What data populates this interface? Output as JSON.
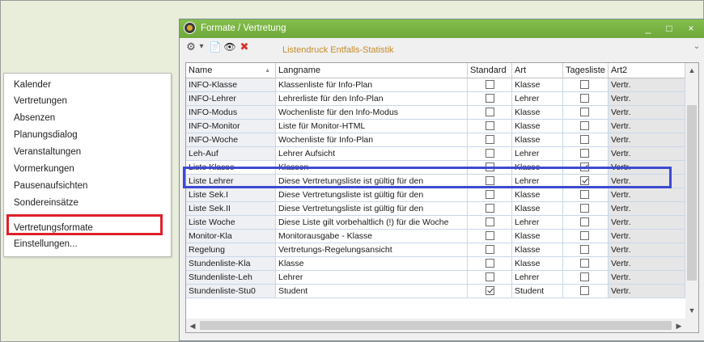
{
  "menu": {
    "items": [
      "Kalender",
      "Vertretungen",
      "Absenzen",
      "Planungsdialog",
      "Veranstaltungen",
      "Vormerkungen",
      "Pausenaufsichten",
      "Sondereinsätze",
      "Vertretungsformate",
      "Einstellungen..."
    ],
    "highlighted_item": "Vertretungsformate"
  },
  "window": {
    "title": "Formate / Vertretung",
    "minimize": "_",
    "maximize": "□",
    "close": "×",
    "titlebar_color": "#78b243"
  },
  "toolbar": {
    "tools": [
      {
        "icon": "tree-settings-icon",
        "glyph": "⚙"
      },
      {
        "icon": "dropdown-arrow-icon",
        "glyph": "▾"
      },
      {
        "icon": "new-document-icon",
        "glyph": "📄"
      },
      {
        "icon": "view-eye-icon",
        "glyph": "👁"
      },
      {
        "icon": "delete-icon",
        "glyph": "✖"
      }
    ],
    "overflow": "⌄"
  },
  "grid": {
    "headers": {
      "name": "Name",
      "langname": "Langname",
      "standard": "Standard",
      "art": "Art",
      "tagesliste": "Tagesliste",
      "art2": "Art2"
    },
    "overlap_text": "Listendruck Entfalls-Statistik",
    "rows": [
      {
        "name": "INFO-Klasse",
        "langname": "Klassenliste für Info-Plan",
        "standard": false,
        "art": "Klasse",
        "tagesliste": false,
        "art2": "Vertr."
      },
      {
        "name": "INFO-Lehrer",
        "langname": "Lehrerliste für den Info-Plan",
        "standard": false,
        "art": "Lehrer",
        "tagesliste": false,
        "art2": "Vertr."
      },
      {
        "name": "INFO-Modus",
        "langname": "Wochenliste für den Info-Modus",
        "standard": false,
        "art": "Klasse",
        "tagesliste": false,
        "art2": "Vertr."
      },
      {
        "name": "INFO-Monitor",
        "langname": "Liste für Monitor-HTML",
        "standard": false,
        "art": "Klasse",
        "tagesliste": false,
        "art2": "Vertr."
      },
      {
        "name": "INFO-Woche",
        "langname": "Wochenliste für Info-Plan",
        "standard": false,
        "art": "Klasse",
        "tagesliste": false,
        "art2": "Vertr."
      },
      {
        "name": "Leh-Auf",
        "langname": "Lehrer Aufsicht",
        "standard": false,
        "art": "Lehrer",
        "tagesliste": false,
        "art2": "Vertr."
      },
      {
        "name": "Liste Klasse",
        "langname": "Klassen",
        "standard": false,
        "art": "Klasse",
        "tagesliste": true,
        "art2": "Vertr.",
        "selected": true
      },
      {
        "name": "Liste Lehrer",
        "langname": "Diese Vertretungsliste ist gültig für den",
        "standard": false,
        "art": "Lehrer",
        "tagesliste": true,
        "art2": "Vertr."
      },
      {
        "name": "Liste Sek.I",
        "langname": "Diese Vertretungsliste ist gültig für den",
        "standard": false,
        "art": "Klasse",
        "tagesliste": false,
        "art2": "Vertr."
      },
      {
        "name": "Liste Sek.II",
        "langname": "Diese Vertretungsliste ist gültig für den",
        "standard": false,
        "art": "Klasse",
        "tagesliste": false,
        "art2": "Vertr."
      },
      {
        "name": "Liste Woche",
        "langname": "Diese Liste gilt vorbehaltlich (!) für die Woche",
        "standard": false,
        "art": "Lehrer",
        "tagesliste": false,
        "art2": "Vertr."
      },
      {
        "name": "Monitor-Kla",
        "langname": "Monitorausgabe - Klasse",
        "standard": false,
        "art": "Klasse",
        "tagesliste": false,
        "art2": "Vertr."
      },
      {
        "name": "Regelung",
        "langname": "Vertretungs-Regelungsansicht",
        "standard": false,
        "art": "Klasse",
        "tagesliste": false,
        "art2": "Vertr."
      },
      {
        "name": "Stundenliste-Kla",
        "langname": "Klasse",
        "standard": false,
        "art": "Klasse",
        "tagesliste": false,
        "art2": "Vertr."
      },
      {
        "name": "Stundenliste-Leh",
        "langname": "Lehrer",
        "standard": false,
        "art": "Lehrer",
        "tagesliste": false,
        "art2": "Vertr."
      },
      {
        "name": "Stundenliste-Stu0",
        "langname": "Student",
        "standard": true,
        "art": "Student",
        "tagesliste": false,
        "art2": "Vertr."
      }
    ]
  },
  "colors": {
    "menu_highlight_border": "#e0202a",
    "row_highlight_border": "#3d4ad1"
  }
}
